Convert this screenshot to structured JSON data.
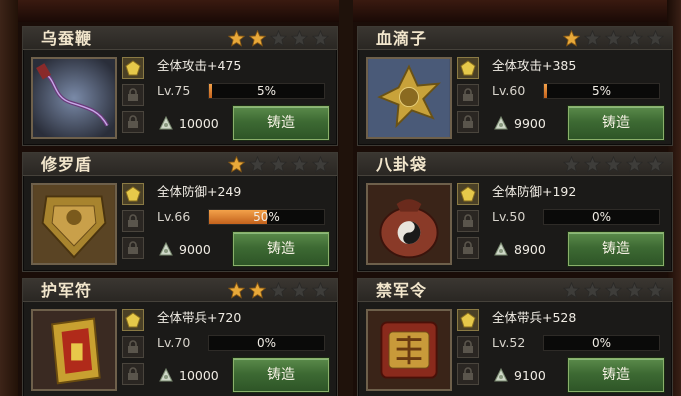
{
  "colors": {
    "star_on": "#e8a93a",
    "star_off": "#3e3d3a",
    "progress": "#e38a35",
    "button": "#3d6a33"
  },
  "cards": [
    {
      "name": "乌蚕鞭",
      "stars": 2,
      "stat": "全体攻击+475",
      "lv": "Lv.75",
      "progress": 0.05,
      "progress_label": "5%",
      "cost": "10000",
      "button": "铸造",
      "icon": "whip-icon"
    },
    {
      "name": "血滴子",
      "stars": 1,
      "stat": "全体攻击+385",
      "lv": "Lv.60",
      "progress": 0.05,
      "progress_label": "5%",
      "cost": "9900",
      "button": "铸造",
      "icon": "blood-drop-weapon-icon"
    },
    {
      "name": "修罗盾",
      "stars": 1,
      "stat": "全体防御+249",
      "lv": "Lv.66",
      "progress": 0.5,
      "progress_label": "50%",
      "cost": "9000",
      "button": "铸造",
      "icon": "shield-icon"
    },
    {
      "name": "八卦袋",
      "stars": 0,
      "stat": "全体防御+192",
      "lv": "Lv.50",
      "progress": 0,
      "progress_label": "0%",
      "cost": "8900",
      "button": "铸造",
      "icon": "bagua-bag-icon"
    },
    {
      "name": "护军符",
      "stars": 2,
      "stat": "全体带兵+720",
      "lv": "Lv.70",
      "progress": 0,
      "progress_label": "0%",
      "cost": "10000",
      "button": "铸造",
      "icon": "talisman-icon"
    },
    {
      "name": "禁军令",
      "stars": 0,
      "stat": "全体带兵+528",
      "lv": "Lv.52",
      "progress": 0,
      "progress_label": "0%",
      "cost": "9100",
      "button": "铸造",
      "icon": "army-token-icon"
    }
  ]
}
